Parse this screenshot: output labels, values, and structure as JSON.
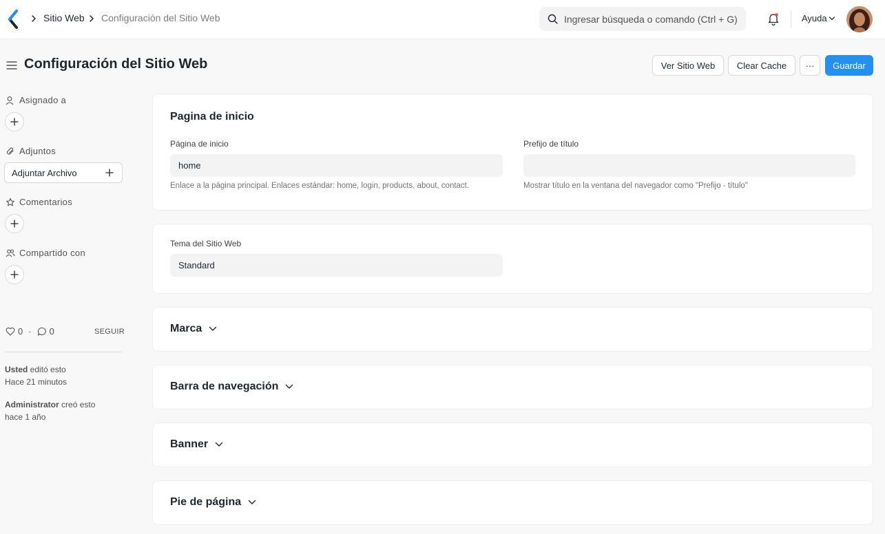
{
  "navbar": {
    "breadcrumbs": [
      "Sitio Web",
      "Configuración del Sitio Web"
    ],
    "search_placeholder": "Ingresar búsqueda o comando (Ctrl + G)",
    "help_label": "Ayuda"
  },
  "header": {
    "title": "Configuración del Sitio Web",
    "view_site_label": "Ver Sitio Web",
    "clear_cache_label": "Clear Cache",
    "more_label": "···",
    "save_label": "Guardar"
  },
  "sidebar": {
    "assigned_label": "Asignado a",
    "attachments_label": "Adjuntos",
    "attach_file_label": "Adjuntar Archivo",
    "comments_label": "Comentarios",
    "shared_label": "Compartido con",
    "likes_count": "0",
    "separator": "·",
    "comments_count": "0",
    "follow_label": "SEGUIR",
    "activity": [
      {
        "user": "Usted",
        "action": " editó esto",
        "time": "Hace 21 minutos"
      },
      {
        "user": "Administrator",
        "action": " creó esto",
        "time": "hace 1 año"
      }
    ]
  },
  "sections": {
    "home": {
      "title": "Pagina de inicio",
      "home_page_label": "Página de inicio",
      "home_page_value": "home",
      "home_page_desc": "Enlace a la página principal. Enlaces estándar: home, login, products, about, contact.",
      "title_prefix_label": "Prefijo de título",
      "title_prefix_value": "",
      "title_prefix_desc": "Mostrar título en la ventana del navegador como \"Prefijo - título\""
    },
    "theme": {
      "label": "Tema del Sitio Web",
      "value": "Standard"
    },
    "collapsed": [
      "Marca",
      "Barra de navegación",
      "Banner",
      "Pie de página"
    ]
  },
  "colors": {
    "primary": "#2490ef",
    "background": "#f8f8f8",
    "notification_dot": "#e24c4c"
  }
}
